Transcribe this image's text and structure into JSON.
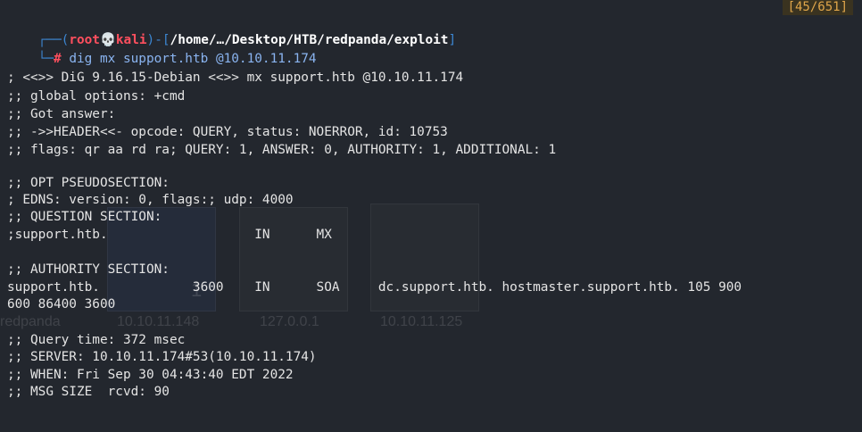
{
  "counter": "[45/651]",
  "prompt": {
    "box_top": "┌──(",
    "user": "root",
    "skull": "💀",
    "host": "kali",
    "box_mid": ")-[",
    "path": "/home/…/Desktop/HTB/redpanda/exploit",
    "box_end": "]",
    "box_bottom": "└─",
    "hash": "#",
    "command": "dig mx support.htb @10.10.11.174"
  },
  "output_lines": [
    "",
    "; <<>> DiG 9.16.15-Debian <<>> mx support.htb @10.10.11.174",
    ";; global options: +cmd",
    ";; Got answer:",
    ";; ->>HEADER<<- opcode: QUERY, status: NOERROR, id: 10753",
    ";; flags: qr aa rd ra; QUERY: 1, ANSWER: 0, AUTHORITY: 1, ADDITIONAL: 1",
    "",
    ";; OPT PSEUDOSECTION:",
    "; EDNS: version: 0, flags:; udp: 4000",
    ";; QUESTION SECTION:",
    ";support.htb.                   IN      MX",
    "",
    ";; AUTHORITY SECTION:",
    "support.htb.            3600    IN      SOA     dc.support.htb. hostmaster.support.htb. 105 900",
    "600 86400 3600",
    "",
    ";; Query time: 372 msec",
    ";; SERVER: 10.10.11.174#53(10.10.11.174)",
    ";; WHEN: Fri Sep 30 04:43:40 EDT 2022",
    ";; MSG SIZE  rcvd: 90"
  ],
  "background_ghost": {
    "labels": [
      "redpanda",
      "10.10.11.148",
      "127.0.0.1",
      "10.10.11.125"
    ],
    "digit": "1"
  }
}
